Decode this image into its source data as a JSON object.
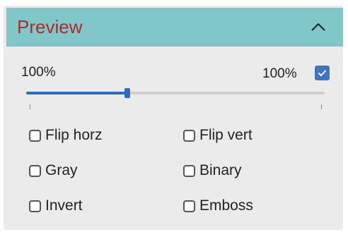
{
  "panel": {
    "title": "Preview",
    "collapse_icon": "chevron-up-icon",
    "header_color": "#7fc7c8",
    "title_color": "#b12a2a"
  },
  "zoom": {
    "left_label": "100%",
    "right_label": "100%",
    "fit_checked": true,
    "slider_value_fraction": 0.34
  },
  "options": [
    {
      "label": "Flip horz",
      "checked": false
    },
    {
      "label": "Flip vert",
      "checked": false
    },
    {
      "label": "Gray",
      "checked": false
    },
    {
      "label": "Binary",
      "checked": false
    },
    {
      "label": "Invert",
      "checked": false
    },
    {
      "label": "Emboss",
      "checked": false
    }
  ],
  "accent_color": "#2d6cc0"
}
